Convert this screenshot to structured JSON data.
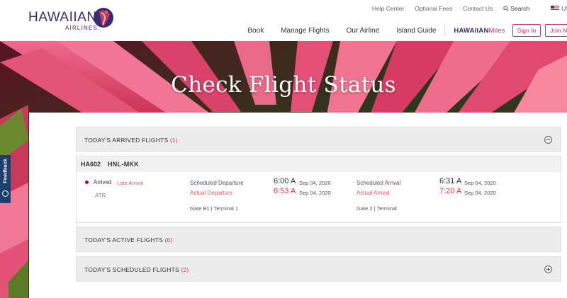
{
  "brand": {
    "name": "HAWAIIAN",
    "sub": "AIRLINES."
  },
  "utility_nav": {
    "help": "Help Center",
    "fees": "Optional Fees",
    "contact": "Contact Us",
    "search": "Search",
    "locale": "US"
  },
  "main_nav": {
    "items": [
      "Book",
      "Manage Flights",
      "Our Airline",
      "Island Guide"
    ],
    "miles_a": "HAWAIIAN",
    "miles_b": "Miles",
    "sign_in": "Sign In",
    "join": "Join No"
  },
  "hero": {
    "title": "Check Flight Status"
  },
  "feedback": {
    "label": "Feedback"
  },
  "arrived": {
    "title": "TODAY'S ARRIVED FLIGHTS",
    "count": "(1)"
  },
  "flight": {
    "number": "HA602",
    "route": "HNL-MKK",
    "status": "Arrived",
    "status_detail": "Late Arrival",
    "aircraft": "ATR",
    "dep": {
      "scheduled_label": "Scheduled Departure",
      "actual_label": "Actual Departure",
      "scheduled_time": "6:00 A",
      "scheduled_date": "Sep 04, 2020",
      "actual_time": "6:53 A",
      "actual_date": "Sep 04, 2020",
      "gate": "Gate B1 | Terminal 1"
    },
    "arr": {
      "scheduled_label": "Scheduled Arrival",
      "actual_label": "Actual Arrival",
      "scheduled_time": "6:31 A",
      "scheduled_date": "Sep 04, 2020",
      "actual_time": "7:20 A",
      "actual_date": "Sep 04, 2020",
      "gate": "Gate 2 | Terminal"
    }
  },
  "active": {
    "title": "TODAY'S ACTIVE FLIGHTS",
    "count": "(0)"
  },
  "scheduled": {
    "title": "TODAY'S SCHEDULED FLIGHTS",
    "count": "(2)"
  },
  "colors": {
    "brand_purple": "#3a2a6e",
    "accent_pink": "#c3356e",
    "alert_red": "#e04040",
    "feedback_blue": "#1e3f6e"
  }
}
